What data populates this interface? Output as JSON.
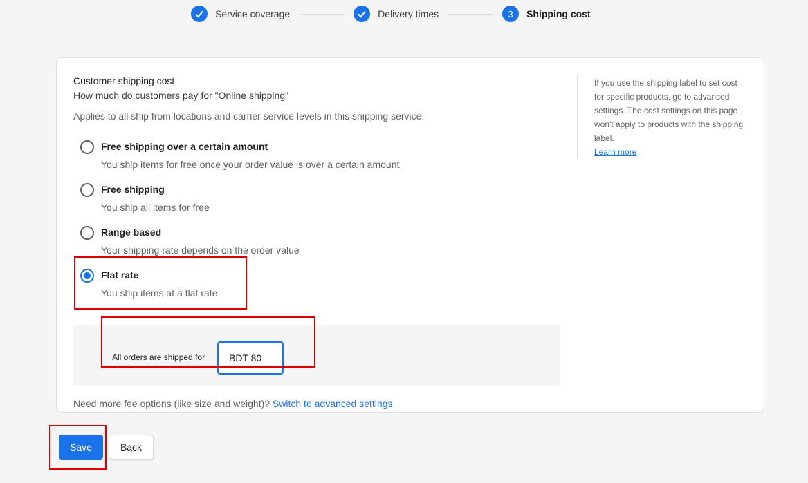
{
  "stepper": {
    "steps": [
      {
        "label": "Service coverage",
        "state": "done"
      },
      {
        "label": "Delivery times",
        "state": "done"
      },
      {
        "label": "Shipping cost",
        "state": "active",
        "number": "3"
      }
    ]
  },
  "card": {
    "title": "Customer shipping cost",
    "subtitle": "How much do customers pay for \"Online shipping\"",
    "description": "Applies to all ship from locations and carrier service levels in this shipping service.",
    "options": [
      {
        "title": "Free shipping over a certain amount",
        "desc": "You ship items for free once your order value is over a certain amount",
        "selected": false
      },
      {
        "title": "Free shipping",
        "desc": "You ship all items for free",
        "selected": false
      },
      {
        "title": "Range based",
        "desc": "Your shipping rate depends on the order value",
        "selected": false
      },
      {
        "title": "Flat rate",
        "desc": "You ship items at a flat rate",
        "selected": true
      }
    ],
    "flat_rate": {
      "label": "All orders are shipped for",
      "value": "BDT 80"
    },
    "more_fees_text": "Need more fee options (like size and weight)?",
    "more_fees_link": "Switch to advanced settings",
    "side_note": "If you use the shipping label to set cost for specific products, go to advanced settings. The cost settings on this page won't apply to products with the shipping label.",
    "learn_more": "Learn more"
  },
  "actions": {
    "save_label": "Save",
    "back_label": "Back"
  },
  "colors": {
    "accent": "#1a73e8",
    "highlight": "#e00000"
  }
}
